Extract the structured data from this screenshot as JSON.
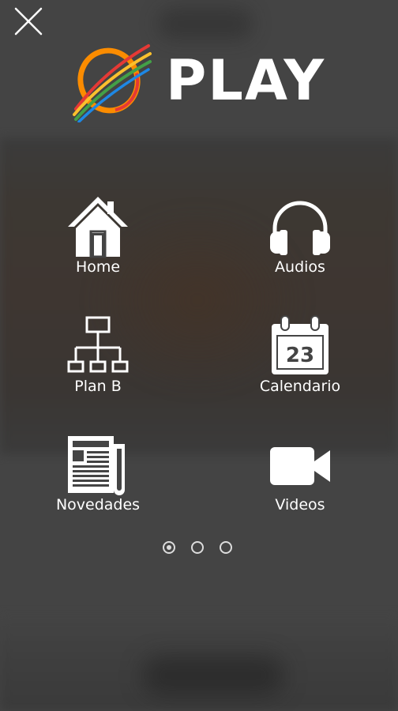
{
  "header": {
    "close_icon": "close-icon",
    "logo_text": "PLAY"
  },
  "menu": {
    "items": [
      {
        "label": "Home",
        "icon": "home-icon"
      },
      {
        "label": "Audios",
        "icon": "headphones-icon"
      },
      {
        "label": "Plan B",
        "icon": "sitemap-icon"
      },
      {
        "label": "Calendario",
        "icon": "calendar-icon",
        "icon_text": "23"
      },
      {
        "label": "Novedades",
        "icon": "newspaper-icon"
      },
      {
        "label": "Videos",
        "icon": "video-camera-icon"
      }
    ]
  },
  "pager": {
    "pages": 3,
    "active": 1
  },
  "colors": {
    "background": "#444444",
    "icon": "#ffffff",
    "logo_ring": [
      "#e53935",
      "#fbc02d",
      "#43a047",
      "#1e88e5",
      "#fb8c00"
    ]
  }
}
